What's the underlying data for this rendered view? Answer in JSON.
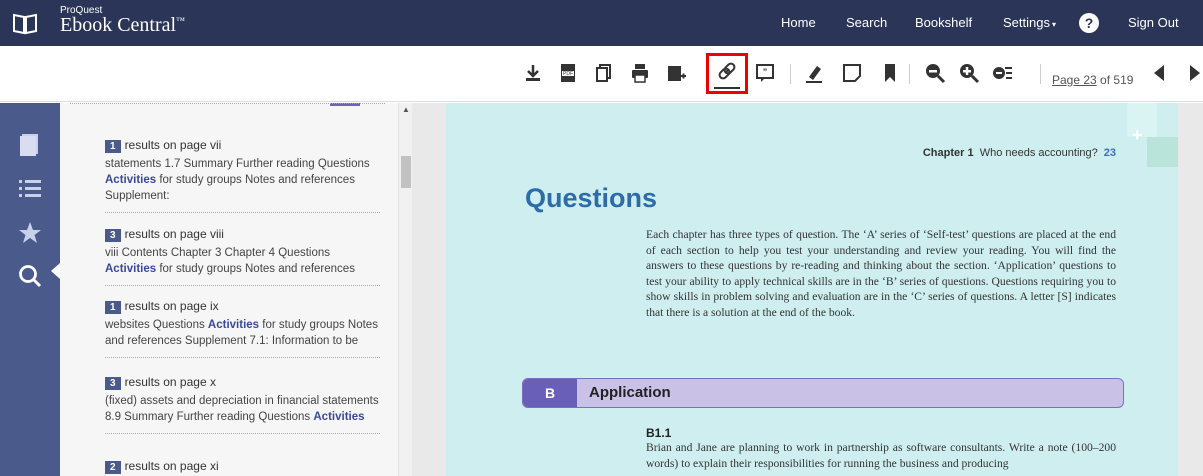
{
  "header": {
    "logo_small": "ProQuest",
    "logo_big": "Ebook Central",
    "logo_tm": "™",
    "nav": {
      "home": "Home",
      "search": "Search",
      "bookshelf": "Bookshelf",
      "settings": "Settings",
      "help": "?",
      "signout": "Sign Out"
    }
  },
  "toolbar": {
    "icons": [
      "download-icon",
      "pdf-icon",
      "copy-icon",
      "print-icon",
      "add-to-bookshelf-icon",
      "link-icon",
      "cite-icon",
      "highlight-icon",
      "note-icon",
      "bookmark-icon",
      "zoom-out-icon",
      "zoom-in-icon",
      "fit-page-icon"
    ],
    "page_current": "Page 23",
    "page_rest": " of 519"
  },
  "results": [
    {
      "count": "1",
      "label": "results on page vii",
      "pre": "statements 1.7 Summary Further reading Questions ",
      "hit": "Activities",
      "post": " for study groups Notes and references Supplement:"
    },
    {
      "count": "3",
      "label": "results on page viii",
      "pre": "viii Contents Chapter 3 Chapter 4 Questions ",
      "hit": "Activities",
      "post": " for study groups Notes and references"
    },
    {
      "count": "1",
      "label": "results on page ix",
      "pre": "websites Questions ",
      "hit": "Activities",
      "post": " for study groups Notes and references Supplement 7.1: Information to be"
    },
    {
      "count": "3",
      "label": "results on page x",
      "pre": "(fixed) assets and depreciation in financial statements 8.9 Summary Further reading Questions ",
      "hit": "Activities",
      "post": ""
    },
    {
      "count": "2",
      "label": "results on page xi",
      "pre": "",
      "hit": "",
      "post": ""
    }
  ],
  "page": {
    "chapter_label": "Chapter 1",
    "chapter_title": "Who needs accounting?",
    "page_number": "23",
    "heading": "Questions",
    "body": "Each chapter has three types of question. The ‘A’ series of ‘Self-test’ questions are placed at the end of each section to help you test your understanding and review your reading. You will find the answers to these questions by re-reading and thinking about the section. ‘Application’ questions to test your ability to apply technical skills are in the ‘B’ series of questions. Questions requiring you to show skills in problem solving and evaluation are in the ‘C’ series of questions. A letter [S] indicates that there is a solution at the end of the book.",
    "section_letter": "B",
    "section_title": "Application",
    "q_id": "B1.1",
    "q_text": "Brian and Jane are planning to work in partnership as software consultants. Write a note (100–200 words) to explain their responsibilities for running the business and producing"
  },
  "colors": {
    "nav_bg": "#2a3557",
    "rail_bg": "#4a5a8a",
    "accent": "#3a4a9a",
    "page_bg": "#cfeef0",
    "heading": "#2d6ca8",
    "highlight_border": "#e00000"
  }
}
